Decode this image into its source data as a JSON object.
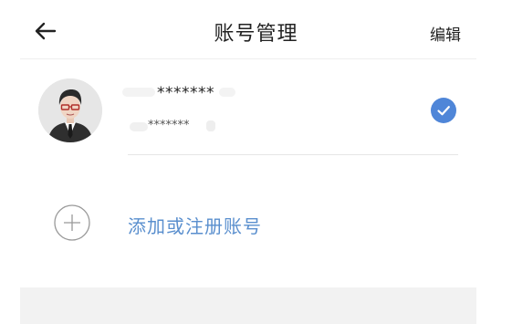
{
  "header": {
    "back_icon": "arrow-left-icon",
    "title": "账号管理",
    "edit_label": "编辑"
  },
  "account": {
    "avatar_icon": "user-avatar-glasses-suit",
    "username": "*******",
    "sub_text": "*******",
    "selected_icon": "check-circle-icon",
    "selected": true
  },
  "add_account": {
    "icon": "plus-circle-icon",
    "label": "添加或注册账号"
  },
  "colors": {
    "accent": "#5a8fce",
    "check": "#4f86d8",
    "text": "#222222",
    "bottom_area": "#f2f2f2"
  }
}
